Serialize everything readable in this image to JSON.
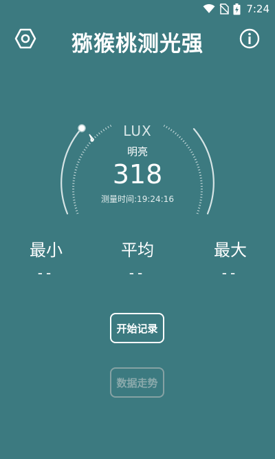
{
  "status_bar": {
    "time": "7:24",
    "icons": [
      "wifi-icon",
      "sim-no-signal-icon",
      "battery-charging-icon"
    ]
  },
  "header": {
    "title": "猕猴桃测光强",
    "left_icon": "hexagon-settings-icon",
    "right_icon": "info-icon"
  },
  "gauge": {
    "unit": "LUX",
    "brightness_level": "明亮",
    "value": "318",
    "measure_time": "测量时间:19:24:16"
  },
  "stats": {
    "min": {
      "label": "最小",
      "value": "--"
    },
    "avg": {
      "label": "平均",
      "value": "--"
    },
    "max": {
      "label": "最大",
      "value": "--"
    }
  },
  "buttons": {
    "start_record": "开始记录",
    "data_trend": "数据走势"
  },
  "colors": {
    "background": "#3c7a80",
    "text": "#ffffff",
    "disabled": "#8aa9ab"
  }
}
